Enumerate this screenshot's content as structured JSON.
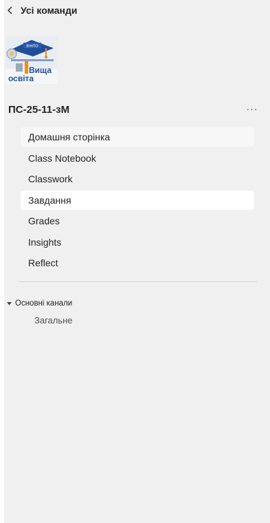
{
  "header": {
    "back_label": "Усі команди",
    "back_icon": "chevron-left-icon"
  },
  "team": {
    "logo_text_top": "ВІНПО",
    "logo_text_1": "Вища",
    "logo_text_2": "освіта",
    "name": "ПС-25-11-зМ",
    "more_label": "···"
  },
  "nav": {
    "items": [
      {
        "label": "Домашня сторінка"
      },
      {
        "label": "Class Notebook"
      },
      {
        "label": "Classwork"
      },
      {
        "label": "Завдання"
      },
      {
        "label": "Grades"
      },
      {
        "label": "Insights"
      },
      {
        "label": "Reflect"
      }
    ]
  },
  "channels": {
    "group_label": "Основні канали",
    "group_icon": "caret-down-icon",
    "items": [
      {
        "label": "Загальне"
      }
    ]
  },
  "colors": {
    "panel_bg": "#f0f0f0",
    "selected_bg": "#ffffff",
    "logo_blue": "#2a5aa8",
    "logo_orange": "#f08a1e"
  }
}
